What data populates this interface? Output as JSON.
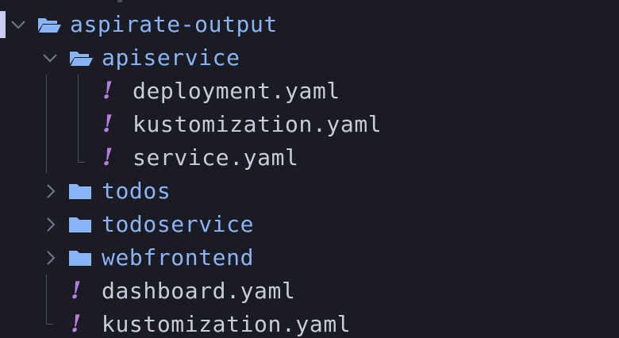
{
  "explorer": {
    "root": {
      "name": "aspirate-output",
      "expanded": true,
      "icon": "folder-open-icon"
    },
    "apiservice": {
      "name": "apiservice",
      "expanded": true,
      "icon": "folder-open-icon",
      "files": [
        {
          "name": "deployment.yaml",
          "icon": "yaml-icon",
          "glyph": "!"
        },
        {
          "name": "kustomization.yaml",
          "icon": "yaml-icon",
          "glyph": "!"
        },
        {
          "name": "service.yaml",
          "icon": "yaml-icon",
          "glyph": "!"
        }
      ]
    },
    "collapsed_folders": [
      {
        "name": "todos",
        "icon": "folder-icon"
      },
      {
        "name": "todoservice",
        "icon": "folder-icon"
      },
      {
        "name": "webfrontend",
        "icon": "folder-icon"
      }
    ],
    "root_files": [
      {
        "name": "dashboard.yaml",
        "icon": "yaml-icon",
        "glyph": "!"
      },
      {
        "name": "kustomization.yaml",
        "icon": "yaml-icon",
        "glyph": "!"
      }
    ]
  },
  "colors": {
    "background": "#1a1b23",
    "folder_text": "#8ab4f8",
    "file_text": "#c8ccd8",
    "yaml_icon": "#b77ee0",
    "folder_icon": "#8ab4f8",
    "chevron": "#6e7386",
    "guide_line": "#4a4d5c",
    "selection_bar": "#c9ccf5"
  }
}
